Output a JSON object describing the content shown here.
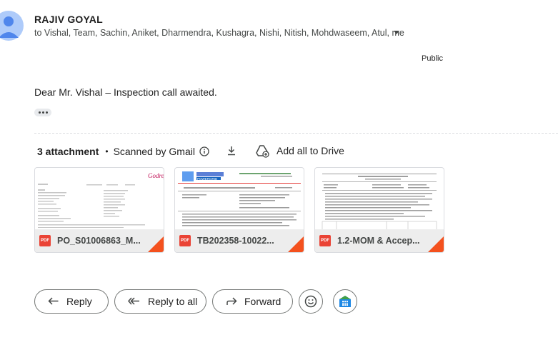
{
  "message": {
    "sender": "RAJIV GOYAL",
    "recipients": "to Vishal, Team, Sachin, Aniket, Dharmendra, Kushagra, Nishi, Nitish, Mohdwaseem, Atul, me",
    "classification": "Public",
    "body": "Dear Mr. Vishal – Inspection call awaited."
  },
  "attachments_bar": {
    "count_label": "3 attachment",
    "scan_label": "Scanned by Gmail",
    "add_all_label": "Add all to Drive"
  },
  "attachments": [
    {
      "name": "PO_S01006863_M...",
      "type_badge": "PDF",
      "thumb_brand": "Godrej"
    },
    {
      "name": "TB202358-10022...",
      "type_badge": "PDF",
      "thumb_brand": "POWERGRID"
    },
    {
      "name": "1.2-MOM & Accep...",
      "type_badge": "PDF",
      "thumb_brand": ""
    }
  ],
  "actions": {
    "reply": "Reply",
    "reply_all": "Reply to all",
    "forward": "Forward"
  },
  "colors": {
    "pdf_red": "#ea4335",
    "corner_orange": "#f4511e",
    "avatar_blue": "#aecbfa",
    "avatar_fg": "#4f86ec"
  }
}
